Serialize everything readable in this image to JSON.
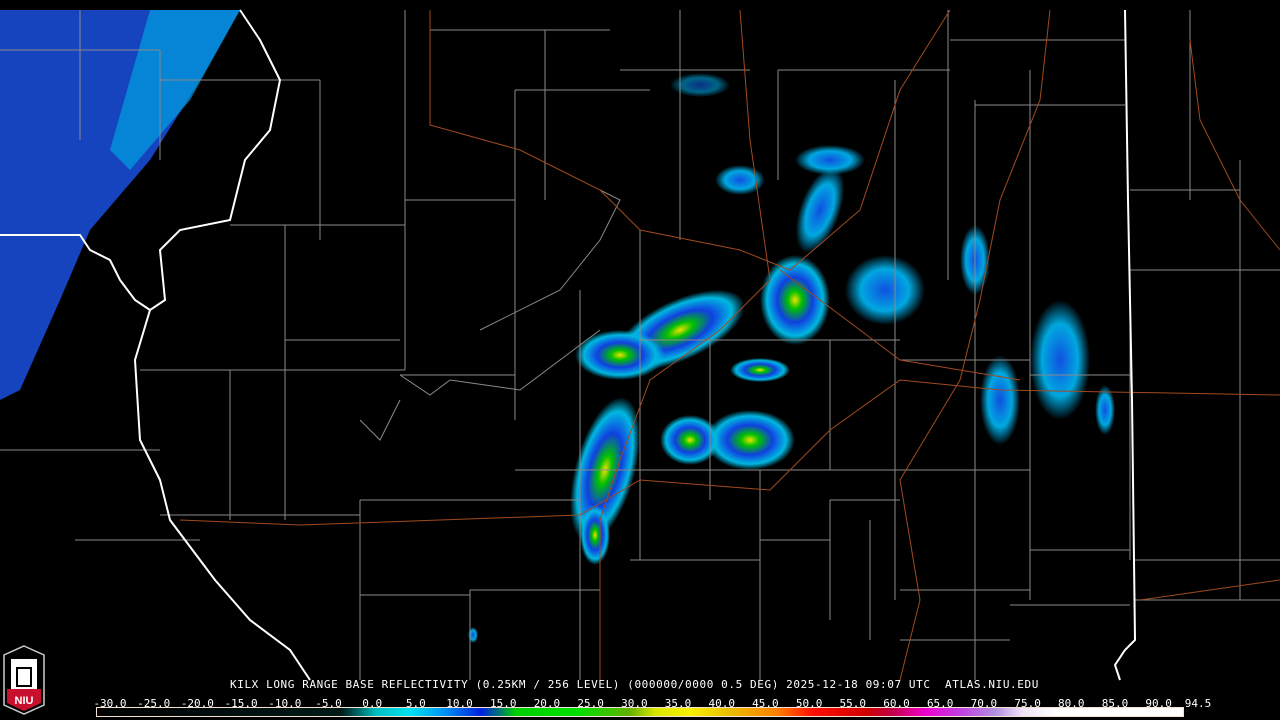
{
  "product_title": "KILX LONG RANGE BASE REFLECTIVITY (0.25KM / 256 LEVEL) (000000/0000 0.5 DEG) 2025-12-18 09:07 UTC  ATLAS.NIU.EDU",
  "logo_text": "NIU",
  "colorbar": {
    "labels": [
      "-30.0",
      "-25.0",
      "-20.0",
      "-15.0",
      "-10.0",
      "-5.0",
      "0.0",
      "5.0",
      "10.0",
      "15.0",
      "20.0",
      "25.0",
      "30.0",
      "35.0",
      "40.0",
      "45.0",
      "50.0",
      "55.0",
      "60.0",
      "65.0",
      "70.0",
      "75.0",
      "80.0",
      "85.0",
      "90.0",
      "94.5"
    ],
    "min": -30,
    "max": 94.5,
    "stops": [
      {
        "v": -30,
        "c": "#000000"
      },
      {
        "v": -2,
        "c": "#001a1a"
      },
      {
        "v": 0,
        "c": "#006a6a"
      },
      {
        "v": 2,
        "c": "#00c0c0"
      },
      {
        "v": 6,
        "c": "#00e0f0"
      },
      {
        "v": 10,
        "c": "#0090f0"
      },
      {
        "v": 14,
        "c": "#0020e0"
      },
      {
        "v": 16,
        "c": "#00707a"
      },
      {
        "v": 18,
        "c": "#00d000"
      },
      {
        "v": 25,
        "c": "#00e000"
      },
      {
        "v": 31,
        "c": "#60b000"
      },
      {
        "v": 34,
        "c": "#d8e800"
      },
      {
        "v": 38,
        "c": "#f8f000"
      },
      {
        "v": 43,
        "c": "#e8b800"
      },
      {
        "v": 48,
        "c": "#ff8000"
      },
      {
        "v": 52,
        "c": "#ff1000"
      },
      {
        "v": 58,
        "c": "#d00000"
      },
      {
        "v": 61,
        "c": "#c00040"
      },
      {
        "v": 65,
        "c": "#f000d0"
      },
      {
        "v": 69,
        "c": "#c040e0"
      },
      {
        "v": 73,
        "c": "#b090e0"
      },
      {
        "v": 76,
        "c": "#f0e0f8"
      },
      {
        "v": 80,
        "c": "#ffffff"
      },
      {
        "v": 94.5,
        "c": "#ffffff"
      }
    ]
  },
  "colors": {
    "county": "#8a8a8a",
    "state": "#ffffff",
    "highway": "#a04a20"
  }
}
